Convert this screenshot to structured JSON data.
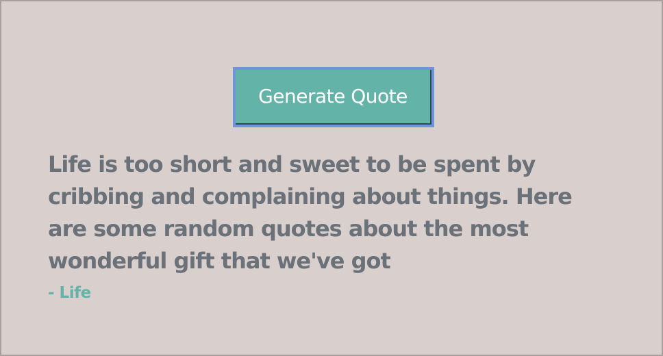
{
  "button": {
    "label": "Generate Quote"
  },
  "quote": {
    "text": "Life is too short and sweet to be spent by cribbing and complaining about things. Here are some random quotes about the most wonderful gift that we've got",
    "author": "- Life"
  },
  "colors": {
    "background": "#d9cfcd",
    "frame_border": "#a89e9a",
    "button_bg": "#63b3a8",
    "button_focus_ring": "#6f94d9",
    "button_text": "#ffffff",
    "quote_text": "#6b7178",
    "author_text": "#63b3a8"
  }
}
